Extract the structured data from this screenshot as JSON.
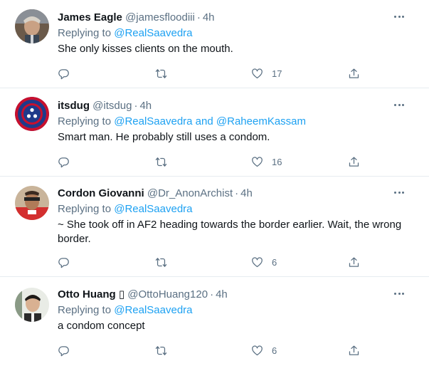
{
  "tweets": [
    {
      "name": "James Eagle",
      "handle": "@jamesfloodiii",
      "time": "4h",
      "reply_prefix": "Replying to",
      "reply_to": "@RealSaavedra",
      "reply_joiner": "",
      "reply_to_2": "",
      "text": "She only kisses clients on the mouth.",
      "likes": "17"
    },
    {
      "name": "itsdug",
      "handle": "@itsdug",
      "time": "4h",
      "reply_prefix": "Replying to",
      "reply_to": "@RealSaavedra",
      "reply_joiner": " and ",
      "reply_to_2": "@RaheemKassam",
      "text": "Smart man. He probably still uses a condom.",
      "likes": "16"
    },
    {
      "name": "Cordon Giovanni",
      "handle": "@Dr_AnonArchist",
      "time": "4h",
      "reply_prefix": "Replying to",
      "reply_to": "@RealSaavedra",
      "reply_joiner": "",
      "reply_to_2": "",
      "text": "~ She took off in AF2 heading towards the border earlier. Wait, the wrong border.",
      "likes": "6"
    },
    {
      "name": "Otto Huang ▯",
      "handle": "@OttoHuang120",
      "time": "4h",
      "reply_prefix": "Replying to",
      "reply_to": "@RealSaavedra",
      "reply_joiner": "",
      "reply_to_2": "",
      "text": "a condom concept",
      "likes": "6"
    }
  ],
  "dot": "·",
  "colors": {
    "link": "#1da1f2",
    "muted": "#5b7083",
    "text": "#0f1419",
    "divider": "#e6ecf0"
  },
  "icons": [
    "reply-icon",
    "retweet-icon",
    "like-icon",
    "share-icon",
    "more-icon"
  ]
}
